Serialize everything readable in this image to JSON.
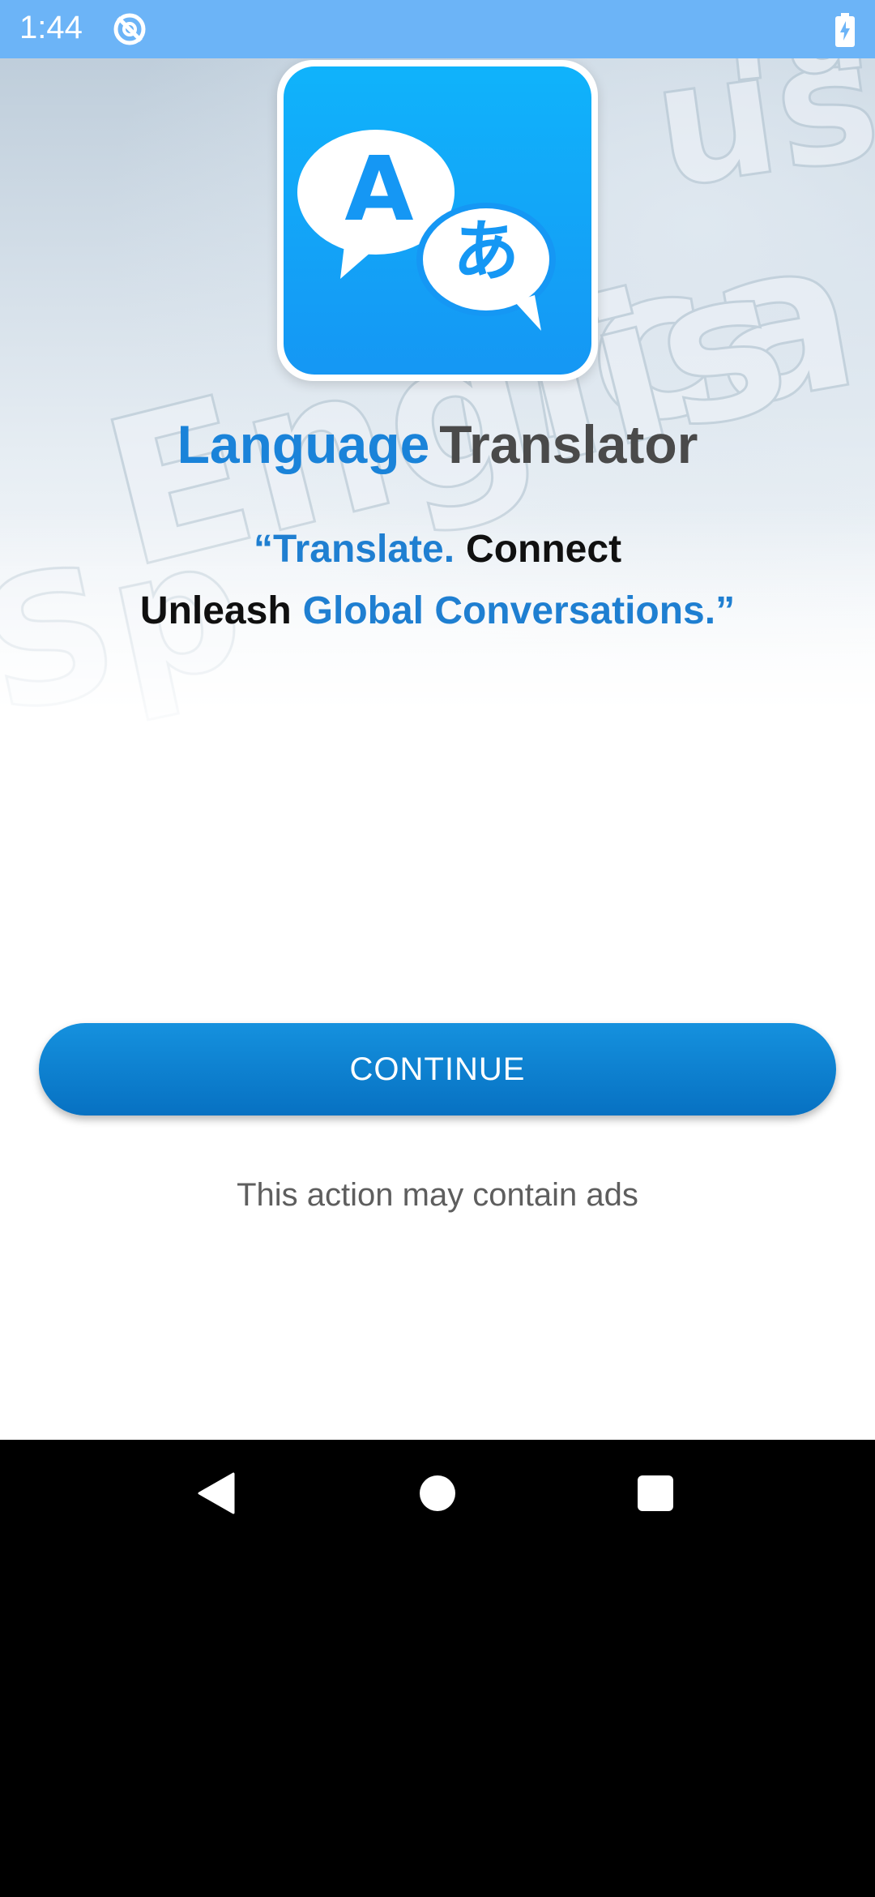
{
  "status_bar": {
    "time": "1:44",
    "icons": [
      "sync-disabled-icon",
      "battery-charging-icon"
    ],
    "background_color": "#6cb4f7"
  },
  "app": {
    "icon": "translate-chat-bubbles-icon",
    "icon_letter_left": "A",
    "icon_letter_right": "あ",
    "title_part1": "Language",
    "title_part2": "Translator",
    "tagline": {
      "line1_blue": "“Translate.",
      "line1_black": "Connect",
      "line2_black": "Unleash",
      "line2_blue": "Global Conversations.”"
    },
    "continue_label": "CONTINUE",
    "ads_note": "This action may contain ads",
    "accent_color": "#1a83d9",
    "button_color": "#0a7ccc"
  },
  "nav_bar": {
    "icons": [
      "back-icon",
      "home-icon",
      "recents-icon"
    ]
  }
}
